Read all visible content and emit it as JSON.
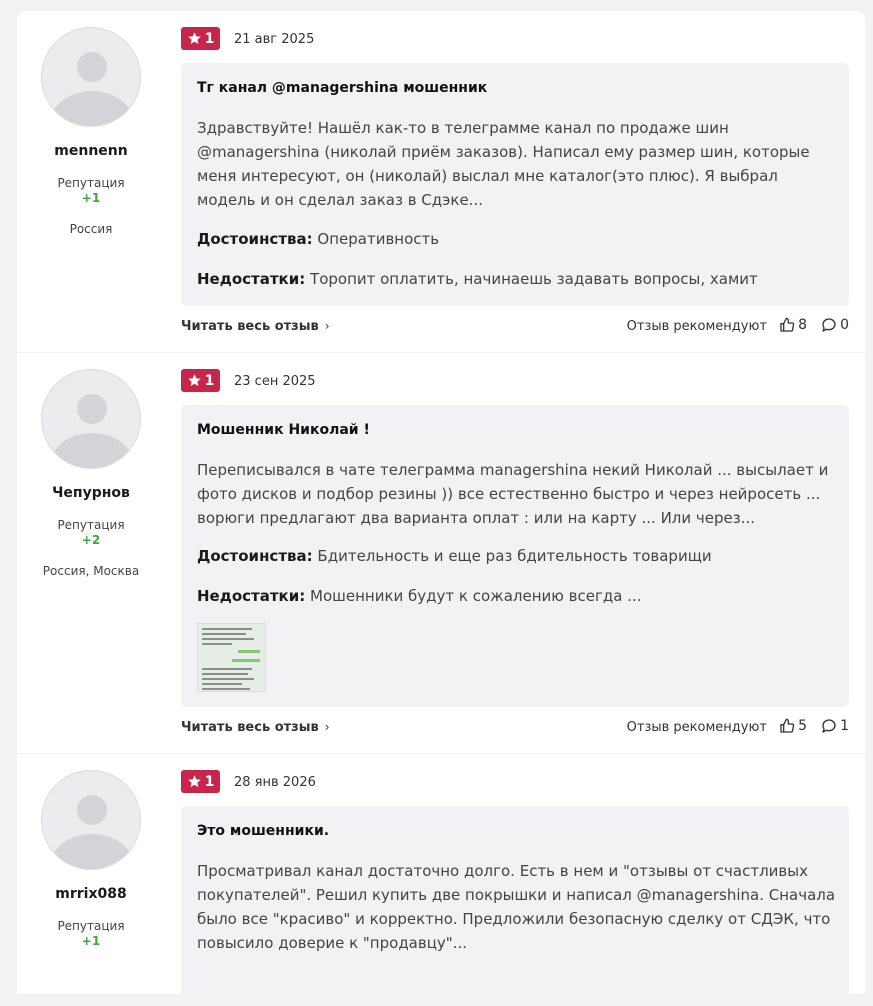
{
  "reviews": [
    {
      "username": "mennenn",
      "reputation_label": "Репутация",
      "reputation_value": "+1",
      "location": "Россия",
      "rating": "1",
      "date": "21 авг 2025",
      "title": "Тг канал @managershina мошенник",
      "text": "Здравствуйте! Нашёл как-то в телеграмме канал по продаже шин @managershina (николай приём заказов). Написал ему размер шин, которые меня интересуют, он (николай) выслал мне каталог(это плюс). Я выбрал модель и он сделал заказ в Сдэке...",
      "pros_label": "Достоинства:",
      "pros": "Оперативность",
      "cons_label": "Недостатки:",
      "cons": "Торопит оплатить, начинаешь задавать вопросы, хамит",
      "read_more": "Читать весь отзыв",
      "recommend_label": "Отзыв рекомендуют",
      "likes": "8",
      "comments": "0"
    },
    {
      "username": "Чепурнов",
      "reputation_label": "Репутация",
      "reputation_value": "+2",
      "location": "Россия, Москва",
      "rating": "1",
      "date": "23 сен 2025",
      "title": "Мошенник Николай !",
      "text": "Переписывался в чате телеграмма managershina некий Николай ... высылает и фото дисков и подбор резины )) все естественно быстро и через нейросеть ... ворюги предлагают два варианта оплат : или на карту ... Или через...",
      "pros_label": "Достоинства:",
      "pros": "Бдительность и еще раз бдительность товарищи",
      "cons_label": "Недостатки:",
      "cons": "Мошенники будут к сожалению всегда ...",
      "read_more": "Читать весь отзыв",
      "recommend_label": "Отзыв рекомендуют",
      "likes": "5",
      "comments": "1"
    },
    {
      "username": "mrrix088",
      "reputation_label": "Репутация",
      "reputation_value": "+1",
      "location": "",
      "rating": "1",
      "date": "28 янв 2026",
      "title": "Это мошенники.",
      "text": "Просматривал канал достаточно долго. Есть в нем и \"отзывы от счастливых покупателей\". Решил купить две покрышки и написал @managershina. Сначала было все \"красиво\" и корректно. Предложили безопасную сделку от СДЭК, что повысило доверие к \"продавцу\"..."
    }
  ],
  "colors": {
    "badge": "#c8254a",
    "reputation": "#3aa83a",
    "box_bg": "#f2f2f4"
  },
  "icons": [
    "star-icon",
    "thumbs-up-icon",
    "comment-icon",
    "chevron-right-icon",
    "user-avatar-placeholder"
  ]
}
